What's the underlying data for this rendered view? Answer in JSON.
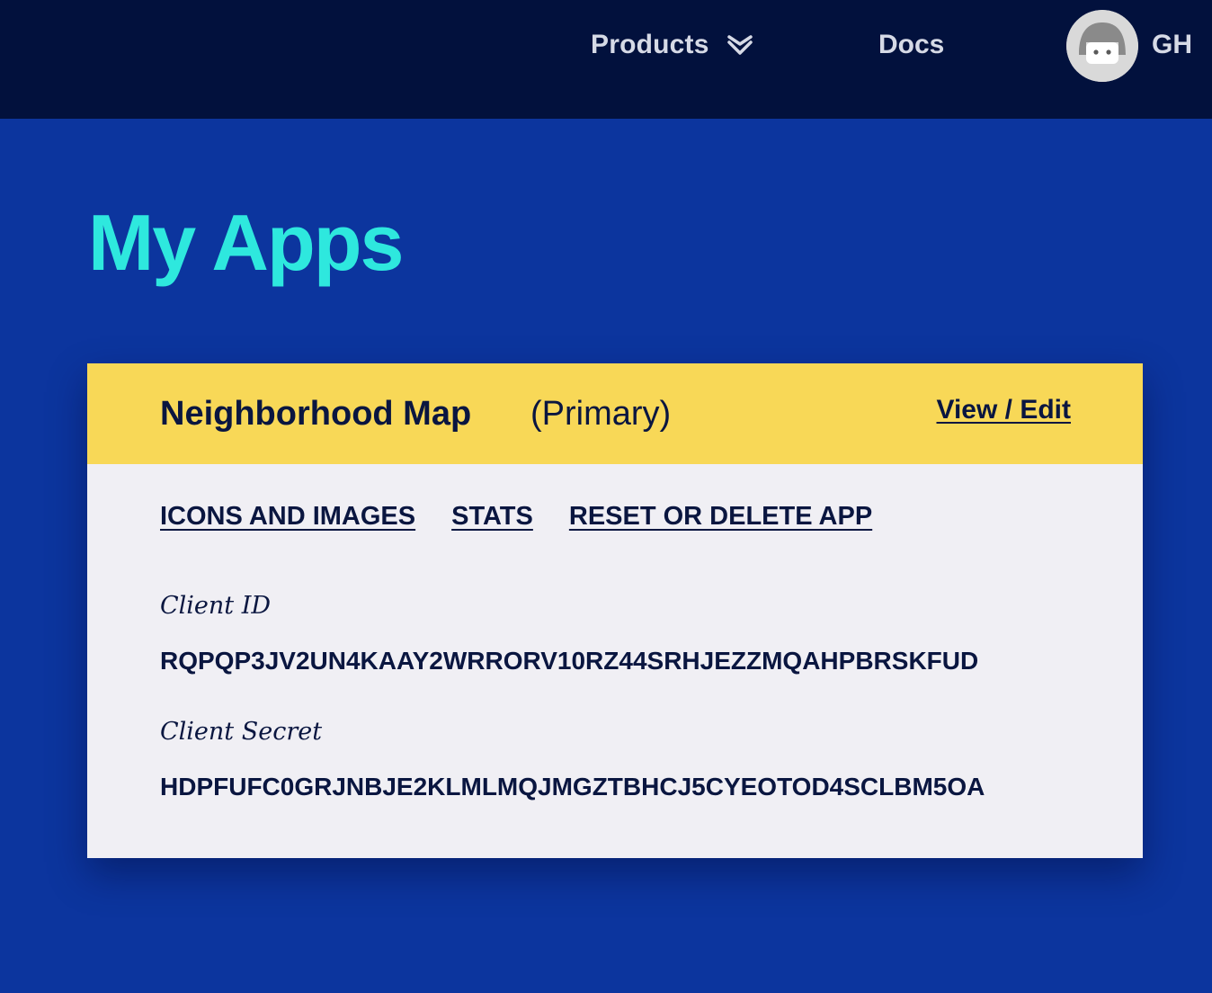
{
  "nav": {
    "products_label": "Products",
    "docs_label": "Docs",
    "user_initials": "GH"
  },
  "page": {
    "title": "My Apps"
  },
  "app": {
    "name": "Neighborhood Map",
    "tag": "(Primary)",
    "view_edit_label": "View / Edit",
    "links": {
      "icons_images": "ICONS AND IMAGES",
      "stats": "STATS",
      "reset_delete": "RESET OR DELETE APP"
    },
    "client_id_label": "Client ID",
    "client_id": "RQPQP3JV2UN4KAAY2WRRORV10RZ44SRHJEZZMQAHPBRSKFUD",
    "client_secret_label": "Client Secret",
    "client_secret": "HDPFUFC0GRJNBJE2KLMLMQJMGZTBHCJ5CYEOTOD4SCLBM5OA"
  },
  "colors": {
    "topbar": "#02113d",
    "background": "#0c359e",
    "title_accent": "#2ee8de",
    "card_header": "#f8d857",
    "card_body": "#f0eff4",
    "text_dark": "#0a1640"
  },
  "icons": {
    "products_dropdown": "chevron-down-icon",
    "avatar": "user-avatar-icon"
  }
}
